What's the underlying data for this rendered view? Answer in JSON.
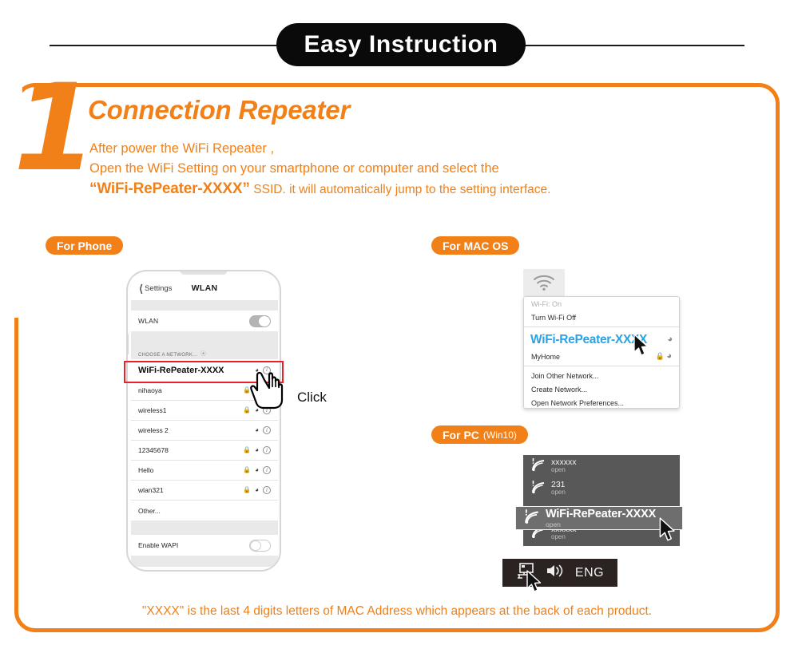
{
  "header": {
    "title": "Easy Instruction"
  },
  "step": {
    "number": "1",
    "title": "Connection Repeater",
    "intro_line1": "After power the WiFi Repeater ,",
    "intro_line2": "Open the WiFi Setting on your smartphone or computer and select the",
    "intro_quote_open": "“",
    "intro_ssid": "WiFi-RePeater-XXXX",
    "intro_quote_close": "”",
    "intro_line3_tail": "SSID.   it will automatically jump to the setting interface."
  },
  "badges": {
    "phone": "For Phone",
    "mac": "For MAC OS",
    "pc": "For PC",
    "pc_sub": "(Win10)"
  },
  "phone": {
    "nav_back": "Settings",
    "nav_title": "WLAN",
    "wlan_label": "WLAN",
    "wlan_toggle_state": "on",
    "choose_network": "CHOOSE A NETWORK...",
    "target_ssid": "WiFi-RePeater-XXXX",
    "networks": [
      {
        "name": "nihaoya",
        "locked": true,
        "wifi": true,
        "info": true
      },
      {
        "name": "wireless1",
        "locked": true,
        "wifi": true,
        "info": true
      },
      {
        "name": "wireless 2",
        "locked": false,
        "wifi": true,
        "info": true
      },
      {
        "name": "12345678",
        "locked": true,
        "wifi": true,
        "info": true
      },
      {
        "name": "Hello",
        "locked": true,
        "wifi": true,
        "info": true
      },
      {
        "name": "wlan321",
        "locked": true,
        "wifi": true,
        "info": true
      }
    ],
    "other_label": "Other...",
    "wapi_label": "Enable WAPI",
    "wapi_toggle_state": "off",
    "click_label": "Click"
  },
  "mac": {
    "wifi_status": "Wi-Fi: On",
    "turn_off": "Turn Wi-Fi Off",
    "target_ssid": "WiFi-RePeater-XXXX",
    "other_network": "MyHome",
    "join_other": "Join Other Network...",
    "create_network": "Create Network...",
    "open_prefs": "Open Network Preferences...",
    "highlight_color": "#29a3e8"
  },
  "pc": {
    "networks": [
      {
        "name": "xxxxxx",
        "status": "open"
      },
      {
        "name": "231",
        "status": "open"
      },
      {
        "name": "xxxxxx",
        "status": "open"
      }
    ],
    "target": {
      "name": "WiFi-RePeater-XXXX",
      "status": "open"
    },
    "taskbar_lang": "ENG"
  },
  "footer": {
    "note": "\"XXXX\" is the last 4 digits letters of MAC Address which appears at the back of each product."
  },
  "colors": {
    "brand_orange": "#f08017",
    "highlight_red": "#e8212b",
    "mac_blue": "#29a3e8",
    "header_black": "#0a0a0a"
  }
}
